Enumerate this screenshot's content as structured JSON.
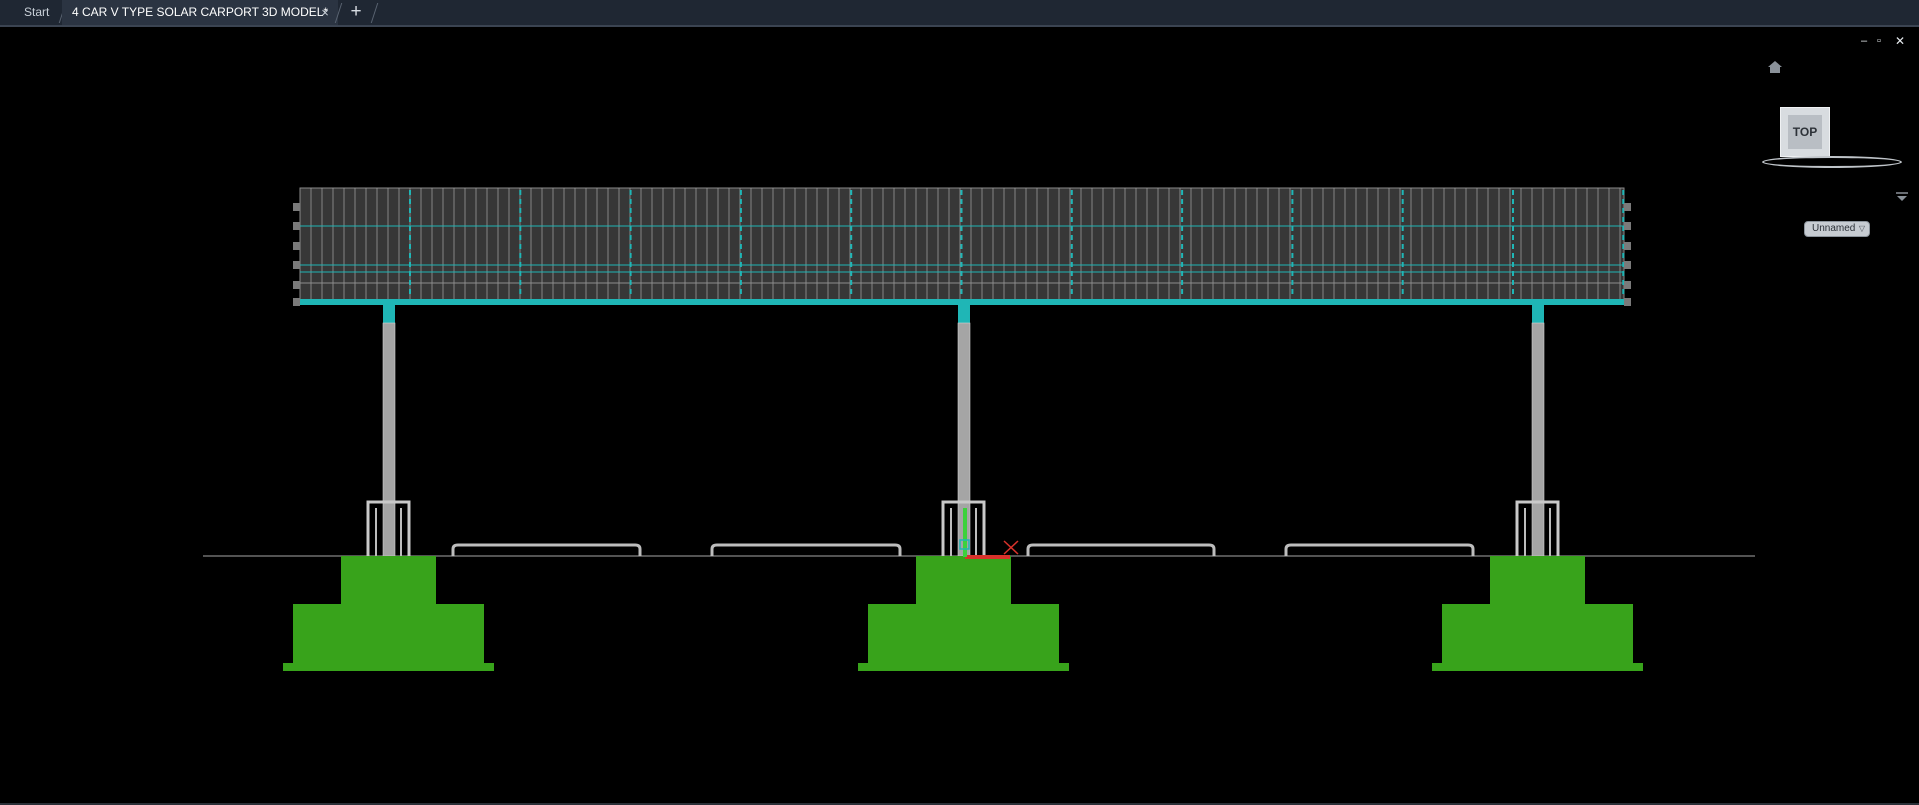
{
  "tabs": {
    "start_label": "Start",
    "active_label": "4 CAR V TYPE SOLAR CARPORT 3D MODEL*",
    "close_glyph": "×",
    "add_glyph": "+"
  },
  "viewcube": {
    "face_label": "TOP"
  },
  "ucs": {
    "dropdown_value": "Unnamed"
  },
  "window_controls": {
    "minimize": "‒",
    "restore": "▫",
    "close": "✕"
  },
  "colors": {
    "background": "#000000",
    "panel_fill": "#373737",
    "grid_cyan": "#1fb6b6",
    "steel_gray": "#a5a5a5",
    "footing_green": "#38a31b",
    "ucs_red": "#d8322b",
    "ucs_green": "#3cd23c"
  }
}
